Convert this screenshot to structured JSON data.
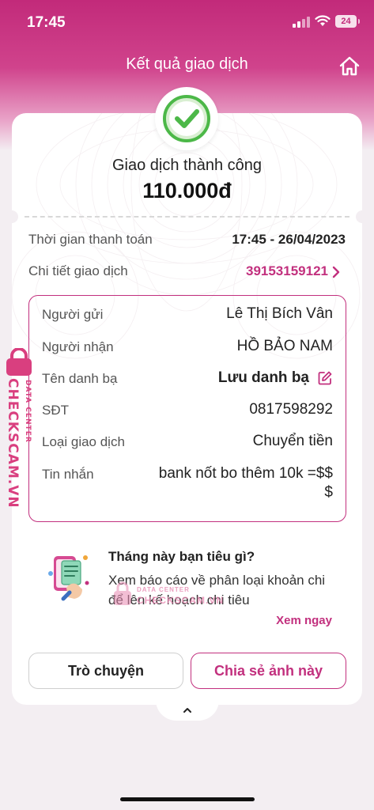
{
  "status_bar": {
    "time": "17:45",
    "battery": "24"
  },
  "nav": {
    "title": "Kết quả giao dịch"
  },
  "result": {
    "status": "Giao dịch thành công",
    "amount": "110.000đ"
  },
  "summary": {
    "time_label": "Thời gian thanh toán",
    "time_value": "17:45 - 26/04/2023",
    "detail_label": "Chi tiết giao dịch",
    "detail_value": "39153159121"
  },
  "details": {
    "sender_label": "Người gửi",
    "sender_value": "Lê Thị Bích Vân",
    "receiver_label": "Người nhận",
    "receiver_value": "HỒ BẢO NAM",
    "contact_label": "Tên danh bạ",
    "contact_value": "Lưu danh bạ",
    "phone_label": "SĐT",
    "phone_value": "0817598292",
    "type_label": "Loại giao dịch",
    "type_value": "Chuyển tiền",
    "message_label": "Tin nhắn",
    "message_value_line1": "bank nốt bo thêm 10k =$$",
    "message_value_line2": "$"
  },
  "promo": {
    "title": "Tháng này bạn tiêu gì?",
    "description": "Xem báo cáo về phân loại khoản chi để lên kế hoạch chi tiêu",
    "link": "Xem ngay"
  },
  "actions": {
    "chat": "Trò chuyện",
    "share": "Chia sẻ ảnh này"
  },
  "watermark": {
    "brand": "CHECKSCAM.VN",
    "sub": "DATA CENTER"
  },
  "colors": {
    "brand_pink": "#c2307e",
    "success_green": "#4cb848"
  }
}
